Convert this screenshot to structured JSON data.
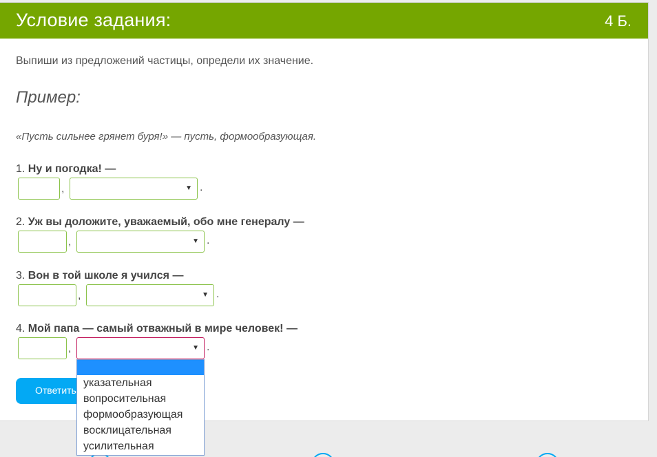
{
  "header": {
    "title": "Условие задания:",
    "points": "4 Б."
  },
  "instruction": "Выпиши из предложений частицы, определи их значение.",
  "example": {
    "title": "Пример:",
    "text": "«Пусть сильнее грянет буря!» — пусть, формообразующая."
  },
  "questions": [
    {
      "num": "1.",
      "text": "Ну и погодка! —"
    },
    {
      "num": "2.",
      "text": "Уж вы доложите, уважаемый, обо мне генералу —"
    },
    {
      "num": "3.",
      "text": "Вон в той школе я учился —"
    },
    {
      "num": "4.",
      "text": "Мой папа — самый отважный в мире человек! —"
    }
  ],
  "punct": {
    "comma": ",",
    "period": "."
  },
  "select_arrow": "▼",
  "answer_button": {
    "label": "Ответить"
  },
  "dropdown": {
    "options": [
      "указательная",
      "вопросительная",
      "формообразующая",
      "восклицательная",
      "усилительная"
    ]
  },
  "colors": {
    "header": "#75a600",
    "field_border": "#8bc34a",
    "active_border": "#c2185b",
    "button": "#03a9f4",
    "highlight": "#1e90ff"
  }
}
